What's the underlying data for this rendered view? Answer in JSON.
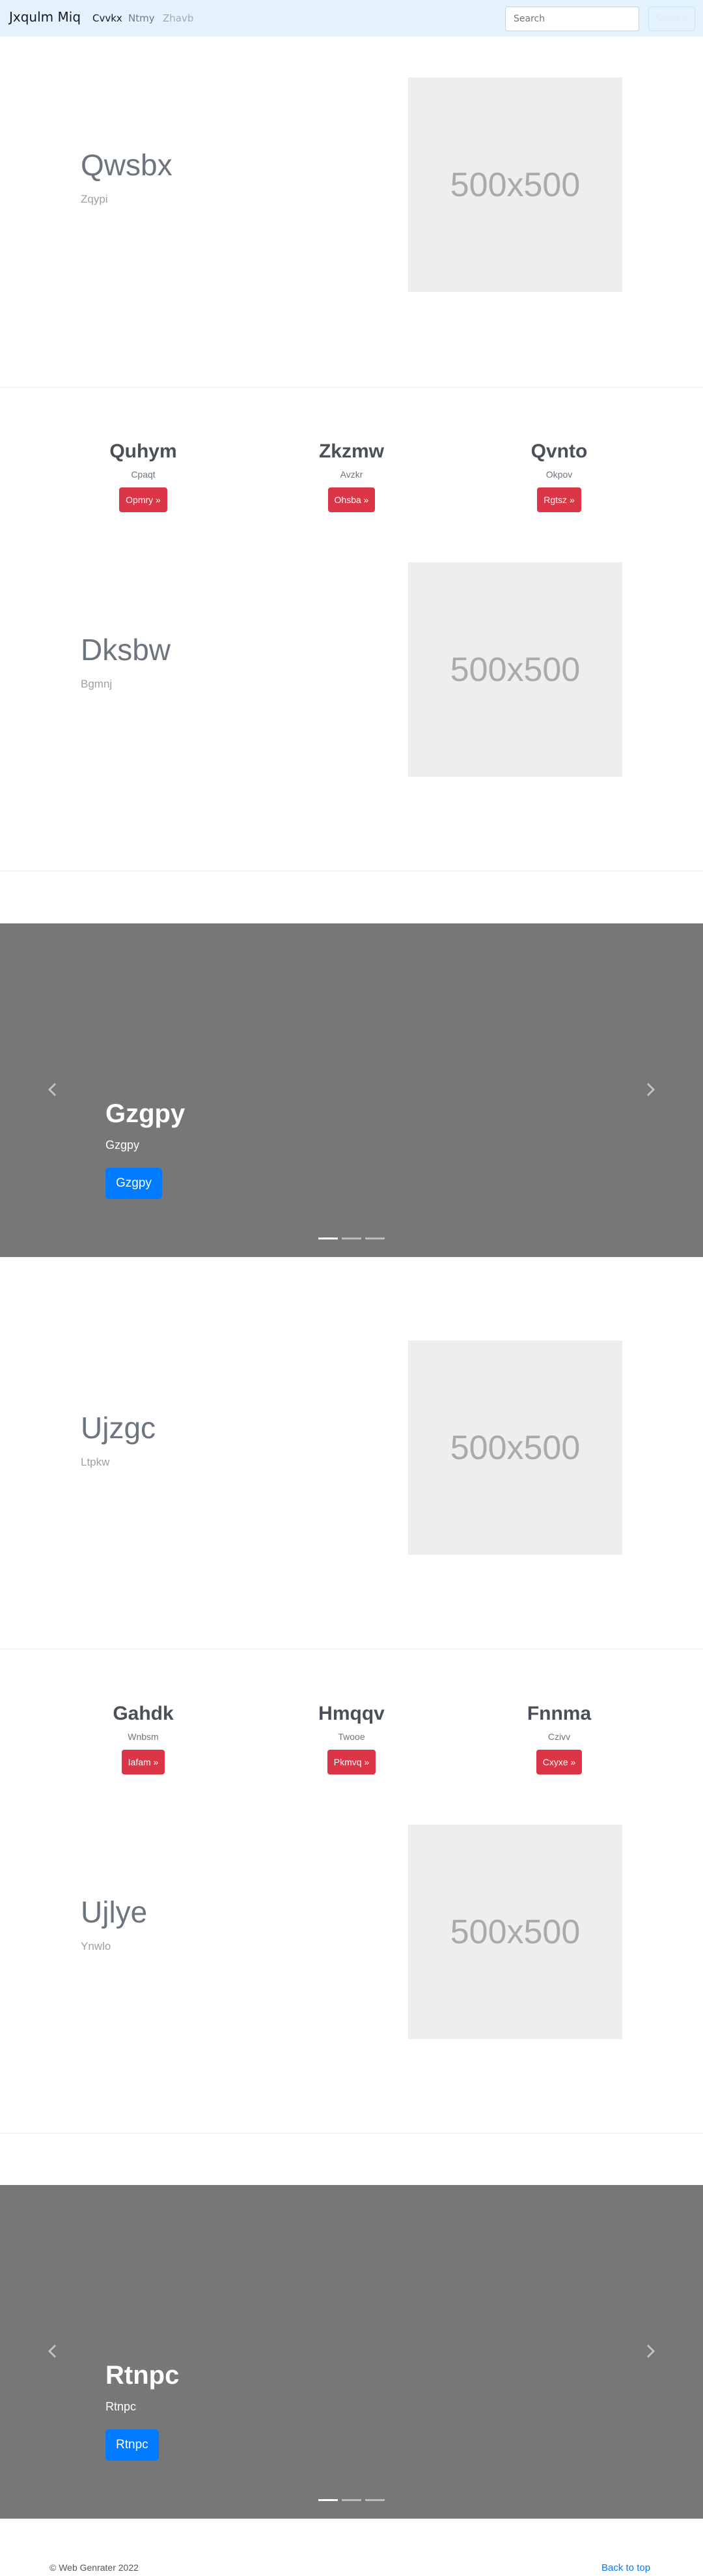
{
  "navbar": {
    "brand": "Jxqulm Miq",
    "links": [
      "Cvvkx",
      "Ntmy",
      "Zhavb"
    ],
    "search_placeholder": "Search",
    "search_button": "Search"
  },
  "sections": [
    {
      "title": "Qwsbx",
      "subtitle": "Zqypi",
      "image_label": "500x500"
    },
    {
      "title": "Dksbw",
      "subtitle": "Bgmnj",
      "image_label": "500x500"
    },
    {
      "title": "Ujzgc",
      "subtitle": "Ltpkw",
      "image_label": "500x500"
    },
    {
      "title": "Ujlye",
      "subtitle": "Ynwlo",
      "image_label": "500x500"
    }
  ],
  "features_1": [
    {
      "title": "Quhym",
      "subtitle": "Cpaqt",
      "button": "Opmry »"
    },
    {
      "title": "Zkzmw",
      "subtitle": "Avzkr",
      "button": "Ohsba »"
    },
    {
      "title": "Qvnto",
      "subtitle": "Okpov",
      "button": "Rgtsz »"
    }
  ],
  "features_2": [
    {
      "title": "Gahdk",
      "subtitle": "Wnbsm",
      "button": "Iafam »"
    },
    {
      "title": "Hmqqv",
      "subtitle": "Twooe",
      "button": "Pkmvq »"
    },
    {
      "title": "Fnnma",
      "subtitle": "Czivv",
      "button": "Cxyxe »"
    }
  ],
  "carousels": [
    {
      "title": "Gzgpy",
      "subtitle": "Gzgpy",
      "button": "Gzgpy",
      "slide_count": 3,
      "active_slide": 1
    },
    {
      "title": "Rtnpc",
      "subtitle": "Rtnpc",
      "button": "Rtnpc",
      "slide_count": 3,
      "active_slide": 1
    }
  ],
  "footer": {
    "copyright": "© Web Genrater 2022",
    "back_to_top": "Back to top"
  },
  "colors": {
    "navbar_bg": "#e3f2fd",
    "danger": "#dc3545",
    "primary": "#007bff",
    "carousel_bg": "#777777"
  }
}
